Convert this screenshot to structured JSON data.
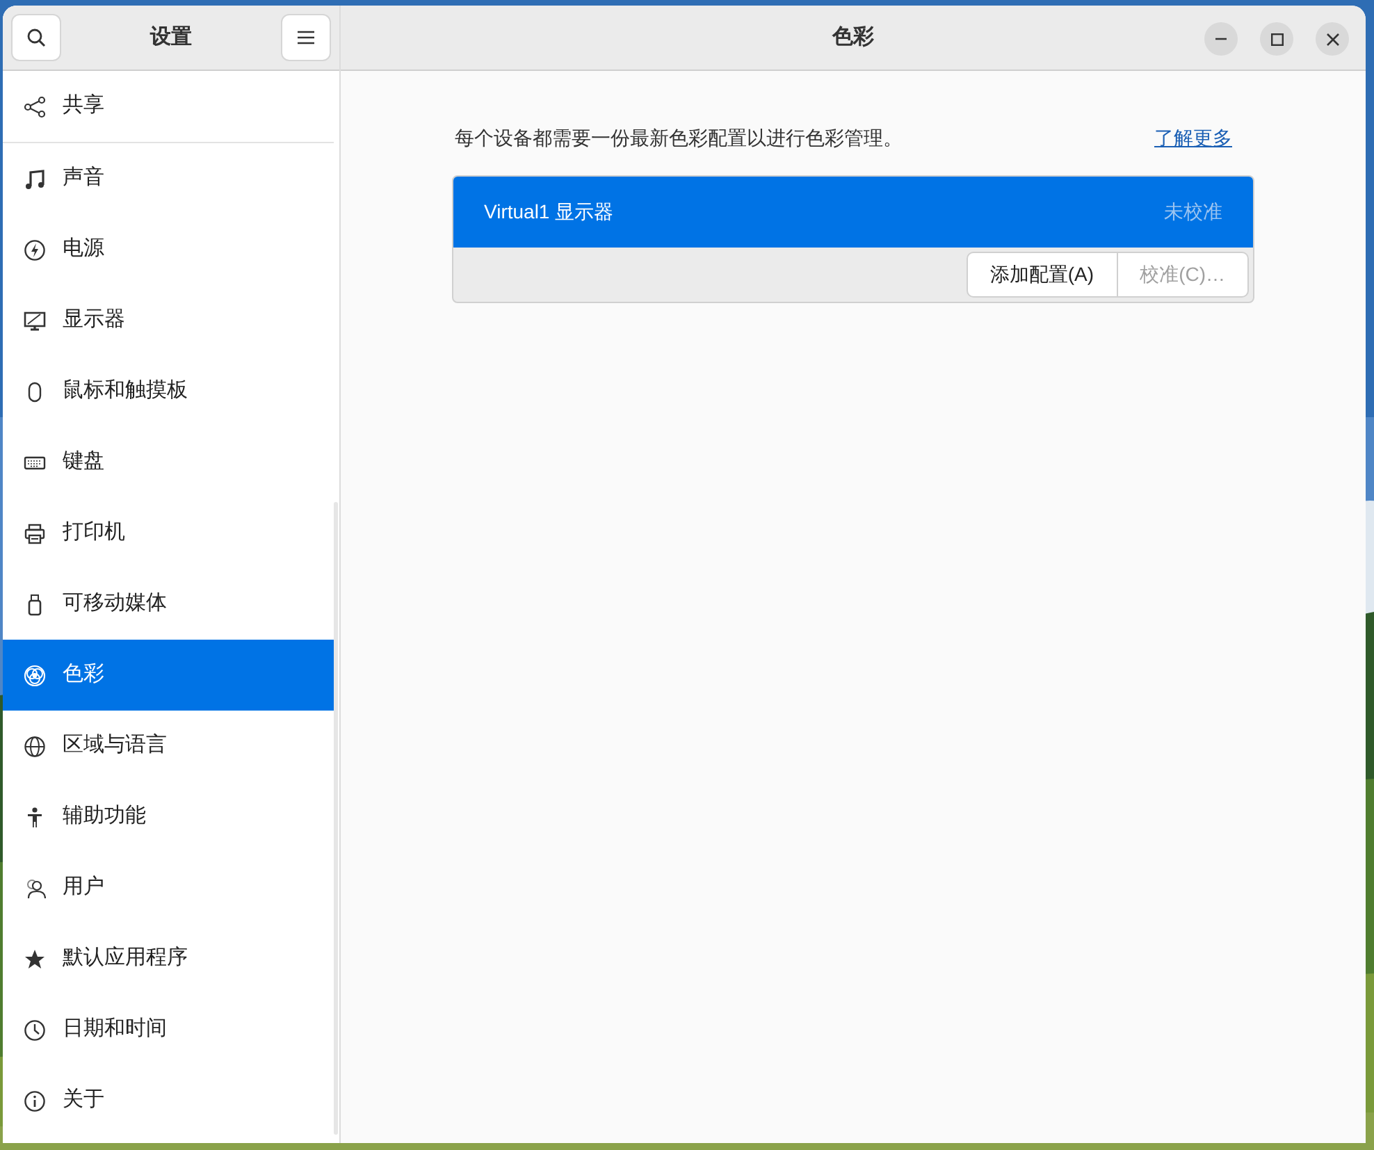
{
  "sidebar": {
    "title": "设置",
    "sections": [
      {
        "items": [
          {
            "label": "共享",
            "selected": false
          }
        ]
      },
      {
        "items": [
          {
            "label": "声音",
            "selected": false
          },
          {
            "label": "电源",
            "selected": false
          },
          {
            "label": "显示器",
            "selected": false
          },
          {
            "label": "鼠标和触摸板",
            "selected": false
          },
          {
            "label": "键盘",
            "selected": false
          },
          {
            "label": "打印机",
            "selected": false
          },
          {
            "label": "可移动媒体",
            "selected": false
          },
          {
            "label": "色彩",
            "selected": true
          },
          {
            "label": "区域与语言",
            "selected": false
          },
          {
            "label": "辅助功能",
            "selected": false
          },
          {
            "label": "用户",
            "selected": false
          },
          {
            "label": "默认应用程序",
            "selected": false
          },
          {
            "label": "日期和时间",
            "selected": false
          },
          {
            "label": "关于",
            "selected": false
          }
        ]
      }
    ]
  },
  "panel": {
    "title": "色彩",
    "description": "每个设备都需要一份最新色彩配置以进行色彩管理。",
    "learn_more_link": "了解更多",
    "devices": [
      {
        "name": "Virtual1 显示器",
        "status": "未校准",
        "selected": true
      }
    ],
    "buttons": [
      {
        "label": "添加配置(A)",
        "disabled": false
      },
      {
        "label": "校准(C)…",
        "disabled": true
      }
    ]
  }
}
